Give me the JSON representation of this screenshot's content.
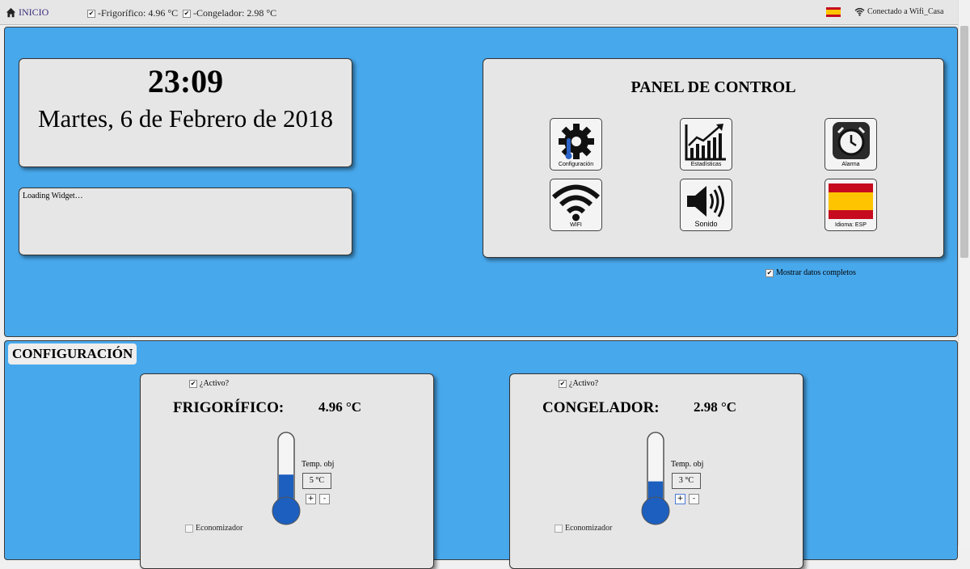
{
  "topbar": {
    "home_label": "INICIO",
    "fridge_status": "-Frigorífico: 4.96 °C",
    "freezer_status": "-Congelador: 2.98 °C",
    "wifi_status": "Conectado a Wifi_Casa",
    "flag_icon": "spain-flag-icon"
  },
  "clock": {
    "time": "23:09",
    "date": "Martes, 6 de Febrero de 2018"
  },
  "widget": {
    "text": "Loading Widget…"
  },
  "panel": {
    "title": "PANEL DE CONTROL",
    "tiles": [
      {
        "label": "Configuración",
        "icon": "gear-icon"
      },
      {
        "label": "Estadísticas",
        "icon": "chart-icon"
      },
      {
        "label": "Alarma",
        "icon": "alarm-clock-icon"
      },
      {
        "label": "WIFI",
        "icon": "wifi-icon"
      },
      {
        "label": "Sonido",
        "icon": "speaker-icon"
      },
      {
        "label": "Idioma: ESP",
        "icon": "spain-flag-icon"
      }
    ]
  },
  "show_full_label": "Mostrar datos completos",
  "config": {
    "title": "CONFIGURACIÓN",
    "devices": [
      {
        "active_label": "¿Activo?",
        "name": "FRIGORÍFICO:",
        "temp": "4.96 °C",
        "target_label": "Temp. obj",
        "target_value": "5 °C",
        "plus": "+",
        "minus": "-",
        "economizer_label": "Economizador",
        "fill_level": 0.45
      },
      {
        "active_label": "¿Activo?",
        "name": "CONGELADOR:",
        "temp": "2.98 °C",
        "target_label": "Temp. obj",
        "target_value": "3 °C",
        "plus": "+",
        "minus": "-",
        "economizer_label": "Economizador",
        "fill_level": 0.35
      }
    ]
  },
  "colors": {
    "section_bg": "#48a8ec",
    "card_bg": "#e6e6e6",
    "mercury": "#1c5fbf"
  }
}
